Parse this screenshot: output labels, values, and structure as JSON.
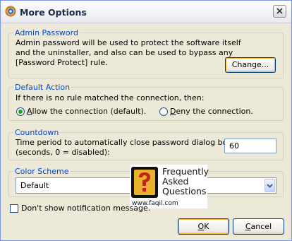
{
  "window": {
    "title": "More Options"
  },
  "admin": {
    "legend": "Admin Password",
    "line1": "Admin password will be used to protect the software itself",
    "line2": "and the uninstaller, and also can be used to bypass any",
    "line3": "[Password Protect] rule.",
    "change_label": "Change..."
  },
  "default_action": {
    "legend": "Default Action",
    "text": "If there is no rule matched the connection, then:",
    "allow_label": "llow the connection (default).",
    "allow_key": "A",
    "deny_label": "eny the connection.",
    "deny_key": "D",
    "selected": "allow"
  },
  "countdown": {
    "legend": "Countdown",
    "line1": "Time period to automatically close password dialog box",
    "line2": "(seconds, 0 = disabled):",
    "value": "60"
  },
  "color_scheme": {
    "legend": "Color Scheme",
    "selected": "Default"
  },
  "notify": {
    "label": "Don't show notification message.",
    "checked": false
  },
  "faq": {
    "line1": "Frequently",
    "line2": "Asked",
    "line3": "Questions",
    "url": "www.faqil.com"
  },
  "buttons": {
    "ok_key": "O",
    "ok_rest": "K",
    "cancel_key": "C",
    "cancel_rest": "ancel"
  },
  "colors": {
    "legend": "#0046d5",
    "face": "#ece9d8",
    "radio_dot": "#21a121"
  }
}
